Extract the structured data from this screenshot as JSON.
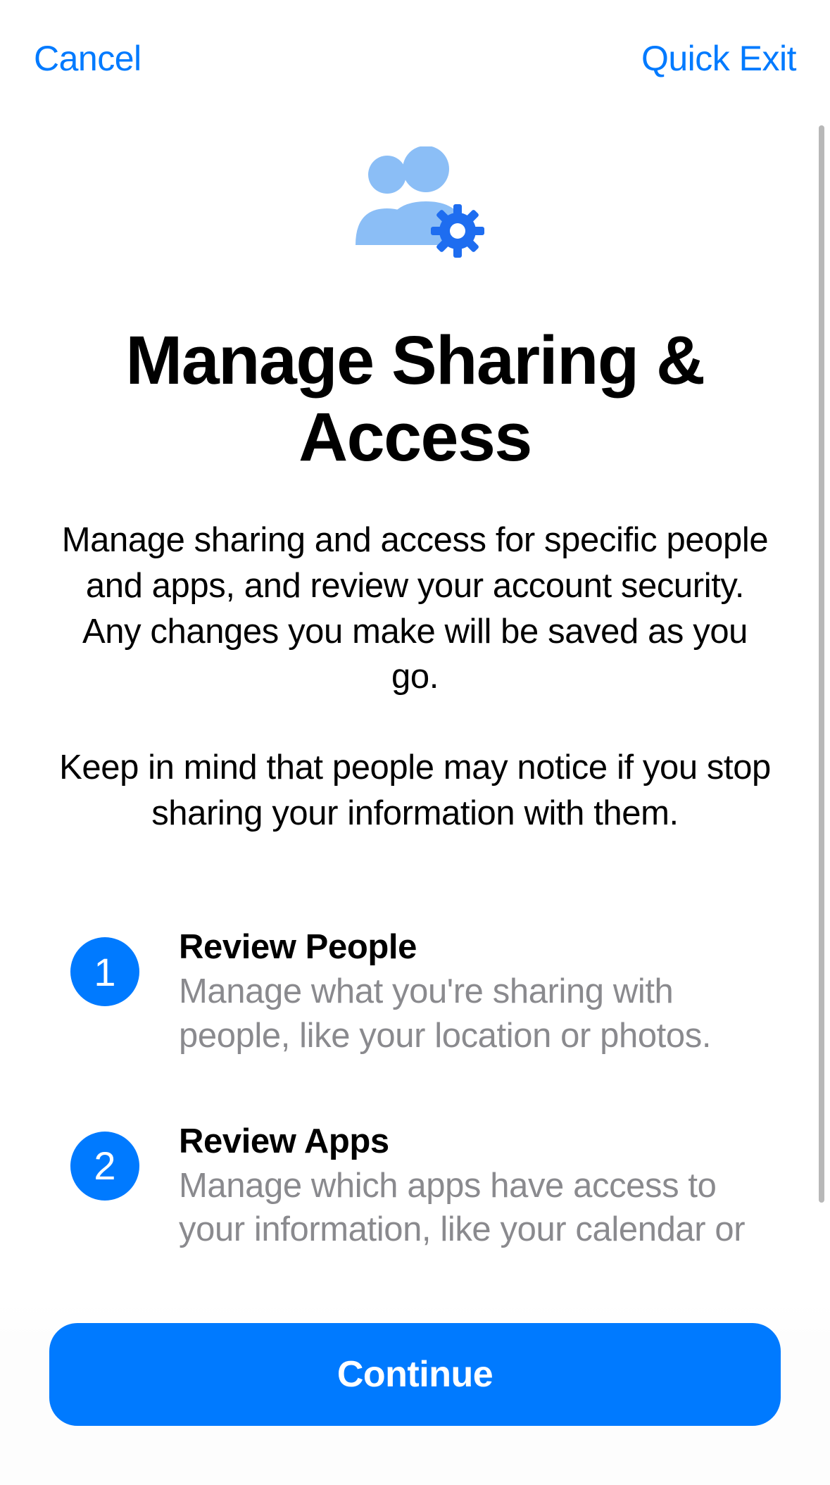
{
  "nav": {
    "cancel": "Cancel",
    "quick_exit": "Quick Exit"
  },
  "colors": {
    "accent": "#007aff",
    "icon_light": "#8BBEF6",
    "icon_gear": "#1e6df0"
  },
  "hero": {
    "icon_name": "people-gear-icon",
    "title": "Manage Sharing & Access",
    "description_p1": "Manage sharing and access for specific people and apps, and review your account security. Any changes you make will be saved as you go.",
    "description_p2": "Keep in mind that people may notice if you stop sharing your information with them."
  },
  "steps": [
    {
      "number": "1",
      "title": "Review People",
      "description": "Manage what you're sharing with people, like your location or photos."
    },
    {
      "number": "2",
      "title": "Review Apps",
      "description": "Manage which apps have access to your information, like your calendar or"
    }
  ],
  "footer": {
    "continue": "Continue"
  }
}
